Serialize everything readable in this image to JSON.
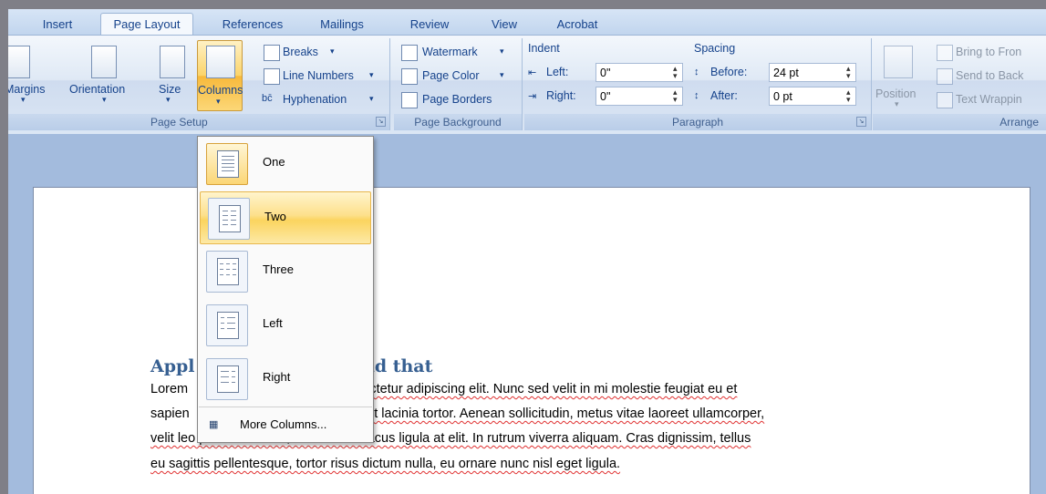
{
  "tabs": [
    "Insert",
    "Page Layout",
    "References",
    "Mailings",
    "Review",
    "View",
    "Acrobat"
  ],
  "page_setup": {
    "margins": "Margins",
    "orientation": "Orientation",
    "size": "Size",
    "columns": "Columns",
    "breaks": "Breaks",
    "line_numbers": "Line Numbers",
    "hyphenation": "Hyphenation",
    "group_label": "Page Setup"
  },
  "page_background": {
    "watermark": "Watermark",
    "page_color": "Page Color",
    "page_borders": "Page Borders",
    "group_label": "Page Background"
  },
  "paragraph": {
    "indent_label": "Indent",
    "left_label": "Left:",
    "left_value": "0\"",
    "right_label": "Right:",
    "right_value": "0\"",
    "spacing_label": "Spacing",
    "before_label": "Before:",
    "before_value": "24 pt",
    "after_label": "After:",
    "after_value": "0 pt",
    "group_label": "Paragraph"
  },
  "arrange": {
    "position": "Position",
    "bring_to_front": "Bring to Fron",
    "send_to_back": "Send to Back",
    "text_wrapping": "Text Wrappin",
    "group_label": "Arrange"
  },
  "columns_menu": {
    "items": [
      "One",
      "Two",
      "Three",
      "Left",
      "Right"
    ],
    "more": "More Columns..."
  },
  "document": {
    "heading_start": "Appl",
    "heading_end": "nd that",
    "lines": [
      {
        "left": "Lorem",
        "right": "nsectetur adipiscing elit. Nunc sed velit in mi molestie feugiat eu et"
      },
      {
        "left": "sapien",
        "right": "amet lacinia tortor. Aenean sollicitudin, metus vitae laoreet ullamcorper,"
      },
      {
        "left": "velit leo pretium mauris, nec ultrices lacus ligula at elit. In rutrum viverra aliquam. Cras dignissim, tellus",
        "right": ""
      },
      {
        "left": "eu sagittis pellentesque, tortor risus dictum nulla, eu ornare nunc nisl eget ligula.",
        "right": ""
      }
    ]
  },
  "colors": {
    "ribbon_text": "#15428b",
    "heading": "#365f91",
    "highlight": "#fbd45f",
    "workspace": "#a3bbdd"
  }
}
